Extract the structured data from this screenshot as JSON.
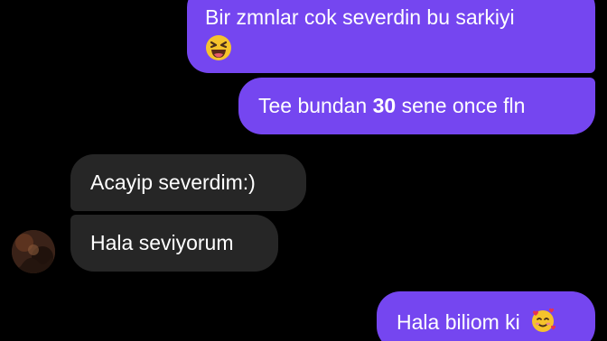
{
  "conversation": {
    "messages": [
      {
        "sender": "me",
        "line1": "Bir zmnlar cok severdin bu sarkiyi",
        "emoji": "grinning-squinting-face"
      },
      {
        "sender": "me",
        "prefix": "Tee bundan ",
        "bold": "30",
        "suffix": " sene once fln"
      },
      {
        "sender": "them",
        "text": "Acayip severdim:)"
      },
      {
        "sender": "them",
        "text": "Hala seviyorum"
      },
      {
        "sender": "me",
        "text": "Hala biliom ki",
        "emoji": "smiling-face-with-hearts"
      }
    ]
  },
  "colors": {
    "background": "#000000",
    "sent_bubble": "#7546f0",
    "received_bubble": "#262626",
    "text": "#ffffff"
  }
}
